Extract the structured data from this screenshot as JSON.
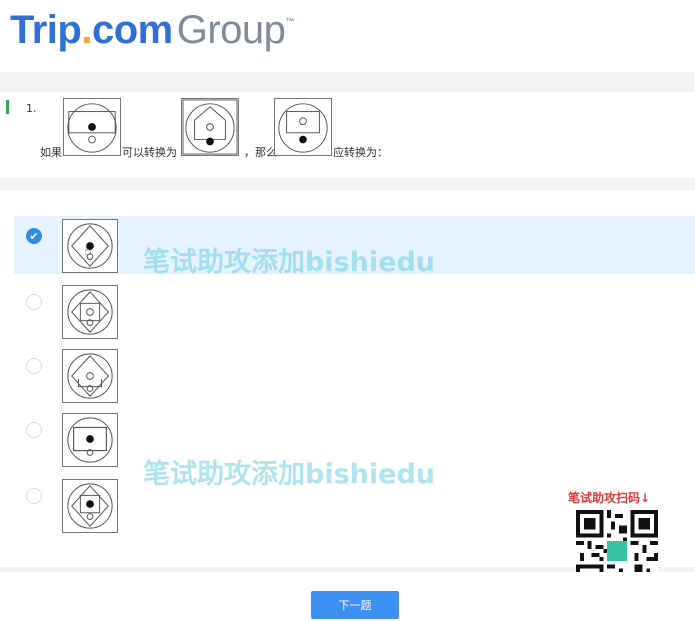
{
  "brand": {
    "trip": "Trip",
    "dot": ".",
    "com": "com",
    "group": "Group",
    "tm": "™"
  },
  "question": {
    "number": "1.",
    "text_if": "如果",
    "text_becomes": "可以转换为",
    "text_then": "，那么",
    "text_should": "应转换为："
  },
  "options": [
    {
      "selected": true,
      "check_glyph": "✔"
    },
    {
      "selected": false
    },
    {
      "selected": false
    },
    {
      "selected": false
    },
    {
      "selected": false
    }
  ],
  "watermarks": [
    "笔试助攻添加bishiedu",
    "笔试助攻添加bishiedu"
  ],
  "promo": {
    "label": "笔试助攻扫码↓"
  },
  "footer": {
    "next_label": "下一题"
  },
  "colors": {
    "brand_blue": "#2f6fd6",
    "brand_orange": "#f2a63a",
    "accent": "#3d8ff0",
    "check": "#2f8de4"
  }
}
